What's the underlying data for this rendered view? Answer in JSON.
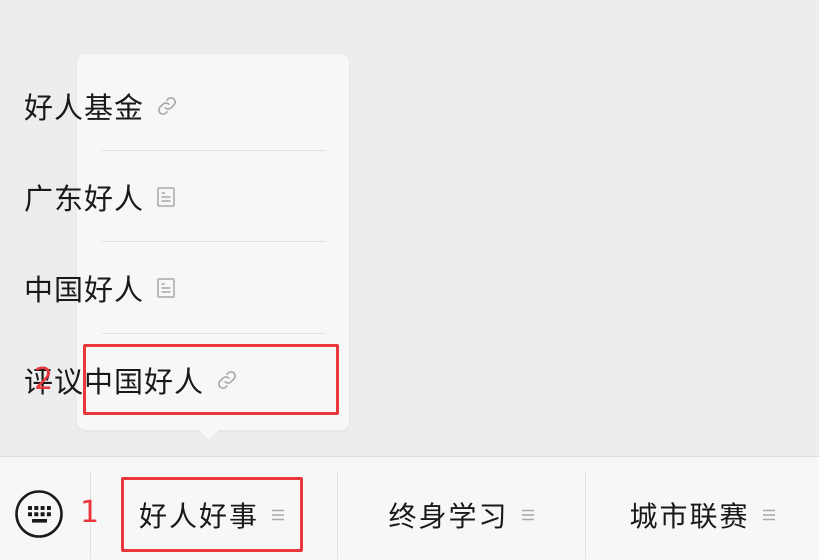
{
  "submenu": {
    "items": [
      {
        "label": "好人基金",
        "icon": "link-icon"
      },
      {
        "label": "广东好人",
        "icon": "article-icon"
      },
      {
        "label": "中国好人",
        "icon": "article-icon"
      },
      {
        "label": "评议中国好人",
        "icon": "link-icon"
      }
    ]
  },
  "bottom_menu": {
    "keyboard_icon": "keyboard-icon",
    "items": [
      {
        "label": "好人好事",
        "icon": "menu-lines-icon"
      },
      {
        "label": "终身学习",
        "icon": "menu-lines-icon"
      },
      {
        "label": "城市联赛",
        "icon": "menu-lines-icon"
      }
    ]
  },
  "annotations": {
    "first": "1",
    "second": "2"
  },
  "colors": {
    "background": "#ededed",
    "panel": "#f7f7f7",
    "text": "#191919",
    "icon": "#a8a8a8",
    "highlight": "#e8383d"
  }
}
